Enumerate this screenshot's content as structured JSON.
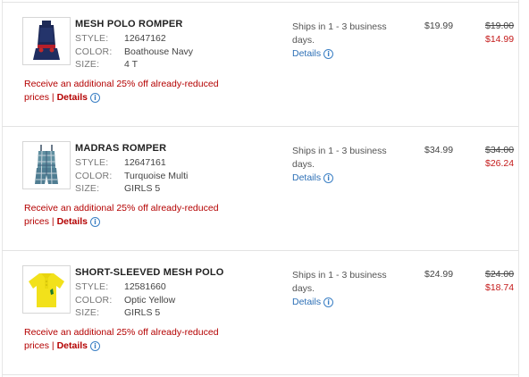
{
  "labels": {
    "style": "STYLE:",
    "color": "COLOR:",
    "size": "SIZE:"
  },
  "items": [
    {
      "name": "MESH POLO ROMPER",
      "style": "12647162",
      "color": "Boathouse Navy",
      "size": "4 T",
      "promo_text": "Receive an additional 25% off already-reduced prices | ",
      "promo_link": "Details",
      "ship_text": "Ships in 1 - 3 business days.",
      "ship_link": "Details",
      "price": "$19.99",
      "original_price": "$19.00",
      "sale_price": "$14.99",
      "thumb_icon": "navy-romper-icon"
    },
    {
      "name": "MADRAS ROMPER",
      "style": "12647161",
      "color": "Turquoise Multi",
      "size": "GIRLS 5",
      "promo_text": "Receive an additional 25% off already-reduced prices | ",
      "promo_link": "Details",
      "ship_text": "Ships in 1 - 3 business days.",
      "ship_link": "Details",
      "price": "$34.99",
      "original_price": "$34.00",
      "sale_price": "$26.24",
      "thumb_icon": "plaid-romper-icon"
    },
    {
      "name": "SHORT-SLEEVED MESH POLO",
      "style": "12581660",
      "color": "Optic Yellow",
      "size": "GIRLS 5",
      "promo_text": "Receive an additional 25% off already-reduced prices | ",
      "promo_link": "Details",
      "ship_text": "Ships in 1 - 3 business days.",
      "ship_link": "Details",
      "price": "$24.99",
      "original_price": "$24.00",
      "sale_price": "$18.74",
      "thumb_icon": "yellow-polo-icon"
    }
  ],
  "colors": {
    "promo": "#b40000",
    "link": "#2c6fb6",
    "sale": "#c41a1a"
  },
  "info_icon_glyph": "i"
}
